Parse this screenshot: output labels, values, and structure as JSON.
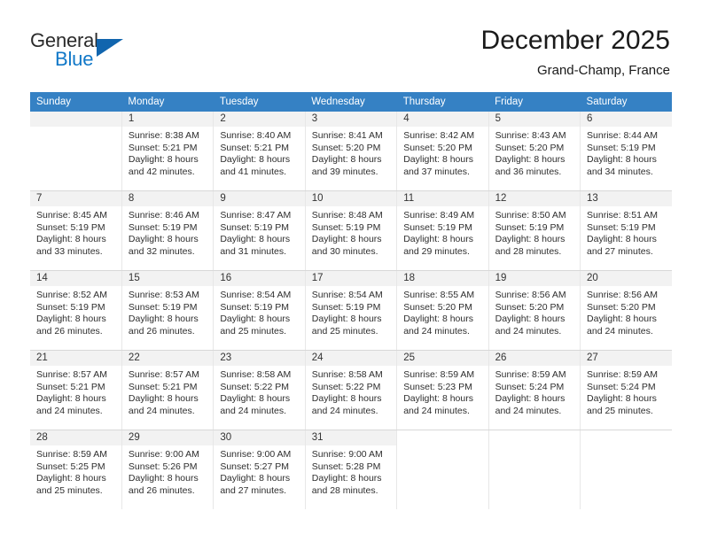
{
  "brand": {
    "name_top": "General",
    "name_bottom": "Blue",
    "accent_color": "#1165ae",
    "text_color": "#2b2b2b"
  },
  "header": {
    "title": "December 2025",
    "subtitle": "Grand-Champ, France"
  },
  "calendar": {
    "header_bg": "#3581c4",
    "header_text_color": "#ffffff",
    "daynum_bg": "#f2f2f2",
    "weekdays": [
      "Sunday",
      "Monday",
      "Tuesday",
      "Wednesday",
      "Thursday",
      "Friday",
      "Saturday"
    ],
    "weeks": [
      [
        {
          "day": "",
          "lines": []
        },
        {
          "day": "1",
          "lines": [
            "Sunrise: 8:38 AM",
            "Sunset: 5:21 PM",
            "Daylight: 8 hours",
            "and 42 minutes."
          ]
        },
        {
          "day": "2",
          "lines": [
            "Sunrise: 8:40 AM",
            "Sunset: 5:21 PM",
            "Daylight: 8 hours",
            "and 41 minutes."
          ]
        },
        {
          "day": "3",
          "lines": [
            "Sunrise: 8:41 AM",
            "Sunset: 5:20 PM",
            "Daylight: 8 hours",
            "and 39 minutes."
          ]
        },
        {
          "day": "4",
          "lines": [
            "Sunrise: 8:42 AM",
            "Sunset: 5:20 PM",
            "Daylight: 8 hours",
            "and 37 minutes."
          ]
        },
        {
          "day": "5",
          "lines": [
            "Sunrise: 8:43 AM",
            "Sunset: 5:20 PM",
            "Daylight: 8 hours",
            "and 36 minutes."
          ]
        },
        {
          "day": "6",
          "lines": [
            "Sunrise: 8:44 AM",
            "Sunset: 5:19 PM",
            "Daylight: 8 hours",
            "and 34 minutes."
          ]
        }
      ],
      [
        {
          "day": "7",
          "lines": [
            "Sunrise: 8:45 AM",
            "Sunset: 5:19 PM",
            "Daylight: 8 hours",
            "and 33 minutes."
          ]
        },
        {
          "day": "8",
          "lines": [
            "Sunrise: 8:46 AM",
            "Sunset: 5:19 PM",
            "Daylight: 8 hours",
            "and 32 minutes."
          ]
        },
        {
          "day": "9",
          "lines": [
            "Sunrise: 8:47 AM",
            "Sunset: 5:19 PM",
            "Daylight: 8 hours",
            "and 31 minutes."
          ]
        },
        {
          "day": "10",
          "lines": [
            "Sunrise: 8:48 AM",
            "Sunset: 5:19 PM",
            "Daylight: 8 hours",
            "and 30 minutes."
          ]
        },
        {
          "day": "11",
          "lines": [
            "Sunrise: 8:49 AM",
            "Sunset: 5:19 PM",
            "Daylight: 8 hours",
            "and 29 minutes."
          ]
        },
        {
          "day": "12",
          "lines": [
            "Sunrise: 8:50 AM",
            "Sunset: 5:19 PM",
            "Daylight: 8 hours",
            "and 28 minutes."
          ]
        },
        {
          "day": "13",
          "lines": [
            "Sunrise: 8:51 AM",
            "Sunset: 5:19 PM",
            "Daylight: 8 hours",
            "and 27 minutes."
          ]
        }
      ],
      [
        {
          "day": "14",
          "lines": [
            "Sunrise: 8:52 AM",
            "Sunset: 5:19 PM",
            "Daylight: 8 hours",
            "and 26 minutes."
          ]
        },
        {
          "day": "15",
          "lines": [
            "Sunrise: 8:53 AM",
            "Sunset: 5:19 PM",
            "Daylight: 8 hours",
            "and 26 minutes."
          ]
        },
        {
          "day": "16",
          "lines": [
            "Sunrise: 8:54 AM",
            "Sunset: 5:19 PM",
            "Daylight: 8 hours",
            "and 25 minutes."
          ]
        },
        {
          "day": "17",
          "lines": [
            "Sunrise: 8:54 AM",
            "Sunset: 5:19 PM",
            "Daylight: 8 hours",
            "and 25 minutes."
          ]
        },
        {
          "day": "18",
          "lines": [
            "Sunrise: 8:55 AM",
            "Sunset: 5:20 PM",
            "Daylight: 8 hours",
            "and 24 minutes."
          ]
        },
        {
          "day": "19",
          "lines": [
            "Sunrise: 8:56 AM",
            "Sunset: 5:20 PM",
            "Daylight: 8 hours",
            "and 24 minutes."
          ]
        },
        {
          "day": "20",
          "lines": [
            "Sunrise: 8:56 AM",
            "Sunset: 5:20 PM",
            "Daylight: 8 hours",
            "and 24 minutes."
          ]
        }
      ],
      [
        {
          "day": "21",
          "lines": [
            "Sunrise: 8:57 AM",
            "Sunset: 5:21 PM",
            "Daylight: 8 hours",
            "and 24 minutes."
          ]
        },
        {
          "day": "22",
          "lines": [
            "Sunrise: 8:57 AM",
            "Sunset: 5:21 PM",
            "Daylight: 8 hours",
            "and 24 minutes."
          ]
        },
        {
          "day": "23",
          "lines": [
            "Sunrise: 8:58 AM",
            "Sunset: 5:22 PM",
            "Daylight: 8 hours",
            "and 24 minutes."
          ]
        },
        {
          "day": "24",
          "lines": [
            "Sunrise: 8:58 AM",
            "Sunset: 5:22 PM",
            "Daylight: 8 hours",
            "and 24 minutes."
          ]
        },
        {
          "day": "25",
          "lines": [
            "Sunrise: 8:59 AM",
            "Sunset: 5:23 PM",
            "Daylight: 8 hours",
            "and 24 minutes."
          ]
        },
        {
          "day": "26",
          "lines": [
            "Sunrise: 8:59 AM",
            "Sunset: 5:24 PM",
            "Daylight: 8 hours",
            "and 24 minutes."
          ]
        },
        {
          "day": "27",
          "lines": [
            "Sunrise: 8:59 AM",
            "Sunset: 5:24 PM",
            "Daylight: 8 hours",
            "and 25 minutes."
          ]
        }
      ],
      [
        {
          "day": "28",
          "lines": [
            "Sunrise: 8:59 AM",
            "Sunset: 5:25 PM",
            "Daylight: 8 hours",
            "and 25 minutes."
          ]
        },
        {
          "day": "29",
          "lines": [
            "Sunrise: 9:00 AM",
            "Sunset: 5:26 PM",
            "Daylight: 8 hours",
            "and 26 minutes."
          ]
        },
        {
          "day": "30",
          "lines": [
            "Sunrise: 9:00 AM",
            "Sunset: 5:27 PM",
            "Daylight: 8 hours",
            "and 27 minutes."
          ]
        },
        {
          "day": "31",
          "lines": [
            "Sunrise: 9:00 AM",
            "Sunset: 5:28 PM",
            "Daylight: 8 hours",
            "and 28 minutes."
          ]
        },
        {
          "day": "",
          "lines": [],
          "blank": true
        },
        {
          "day": "",
          "lines": [],
          "blank": true
        },
        {
          "day": "",
          "lines": [],
          "blank": true
        }
      ]
    ]
  }
}
